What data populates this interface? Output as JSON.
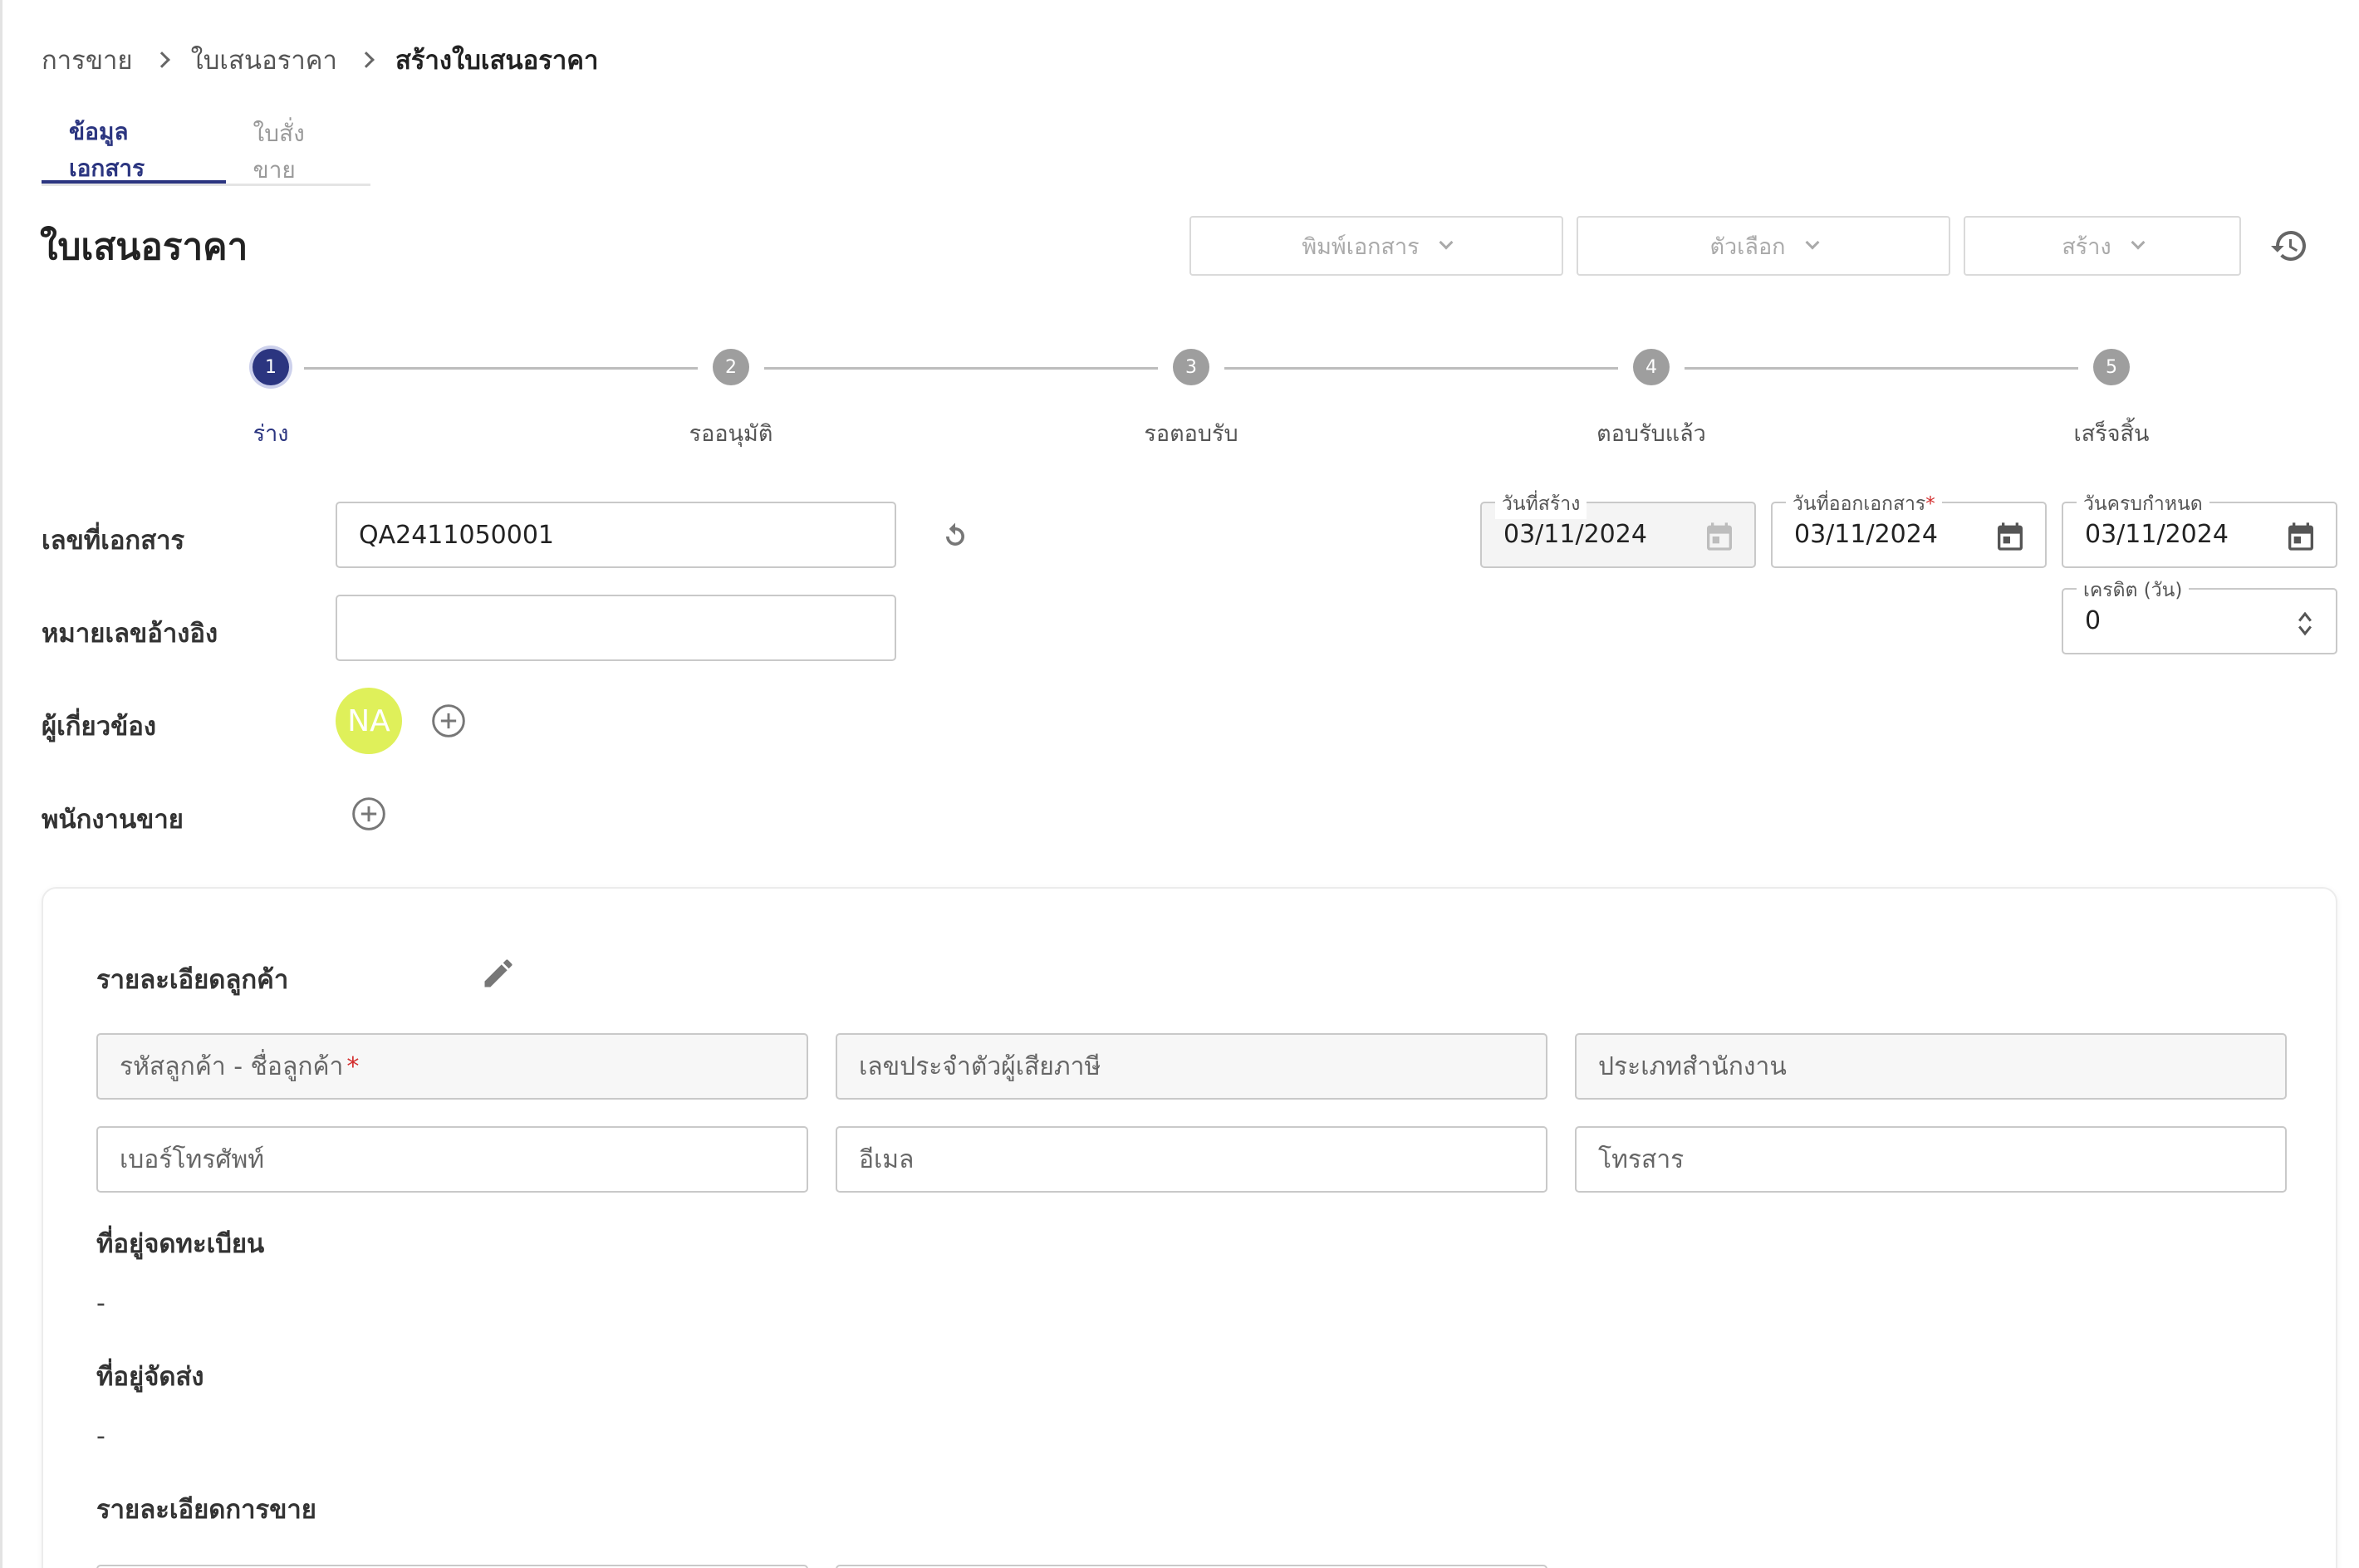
{
  "breadcrumb": {
    "items": [
      "การขาย",
      "ใบเสนอราคา"
    ],
    "current": "สร้างใบเสนอราคา"
  },
  "tabs": [
    {
      "label": "ข้อมูลเอกสาร",
      "active": true
    },
    {
      "label": "ใบสั่งขาย",
      "active": false
    }
  ],
  "page_title": "ใบเสนอราคา",
  "toolbar": {
    "print_label": "พิมพ์เอกสาร",
    "options_label": "ตัวเลือก",
    "create_label": "สร้าง",
    "history_icon": "history-icon"
  },
  "stepper": {
    "steps": [
      {
        "number": "1",
        "label": "ร่าง",
        "active": true
      },
      {
        "number": "2",
        "label": "รออนุมัติ",
        "active": false
      },
      {
        "number": "3",
        "label": "รอตอบรับ",
        "active": false
      },
      {
        "number": "4",
        "label": "ตอบรับแล้ว",
        "active": false
      },
      {
        "number": "5",
        "label": "เสร็จสิ้น",
        "active": false
      }
    ]
  },
  "form": {
    "doc_number_label": "เลขที่เอกสาร",
    "doc_number_value": "QA2411050001",
    "reference_label": "หมายเลขอ้างอิง",
    "reference_value": "",
    "related_label": "ผู้เกี่ยวข้อง",
    "related_avatar_initials": "NA",
    "salesperson_label": "พนักงานขาย"
  },
  "dates": {
    "created_label": "วันที่สร้าง",
    "created_value": "03/11/2024",
    "issued_label": "วันที่ออกเอกสาร",
    "issued_required": "*",
    "issued_value": "03/11/2024",
    "due_label": "วันครบกำหนด",
    "due_value": "03/11/2024",
    "credit_label": "เครดิต (วัน)",
    "credit_value": "0"
  },
  "customer": {
    "title": "รายละเอียดลูกค้า",
    "code_name_placeholder": "รหัสลูกค้า - ชื่อลูกค้า",
    "required_mark": "*",
    "tax_id_placeholder": "เลขประจำตัวผู้เสียภาษี",
    "office_type_placeholder": "ประเภทสำนักงาน",
    "phone_placeholder": "เบอร์โทรศัพท์",
    "email_placeholder": "อีเมล",
    "fax_placeholder": "โทรสาร",
    "registered_address_title": "ที่อยู่จดทะเบียน",
    "registered_address_value": "-",
    "delivery_address_title": "ที่อยู่จัดส่ง",
    "delivery_address_value": "-",
    "sales_details_title": "รายละเอียดการขาย"
  },
  "colors": {
    "primary": "#2b3580",
    "avatar": "#dff05a",
    "required": "#d32f2f"
  }
}
